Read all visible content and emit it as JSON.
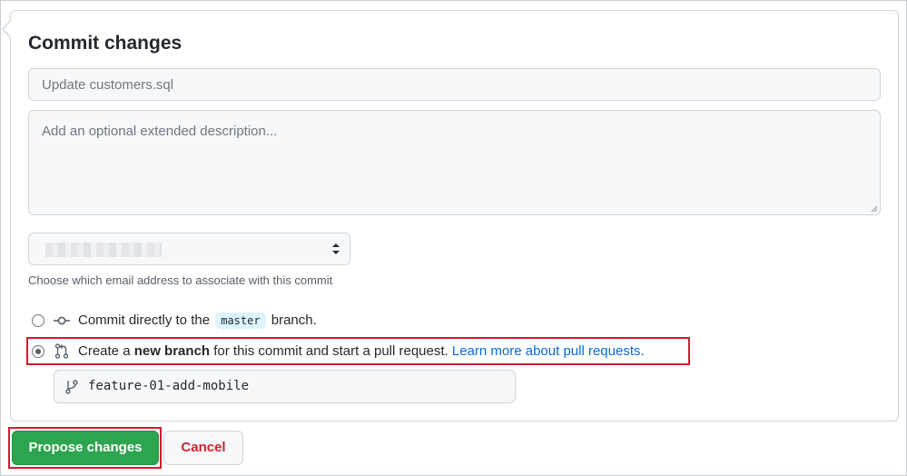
{
  "form": {
    "title": "Commit changes",
    "summary_placeholder": "Update customers.sql",
    "description_placeholder": "Add an optional extended description...",
    "email_help": "Choose which email address to associate with this commit"
  },
  "options": {
    "direct": {
      "prefix": "Commit directly to the",
      "branch": "master",
      "suffix": "branch."
    },
    "new_branch": {
      "prefix": "Create a",
      "bold": "new branch",
      "suffix": "for this commit and start a pull request.",
      "link": "Learn more about pull requests.",
      "selected": true
    }
  },
  "branch_name": "feature-01-add-mobile",
  "buttons": {
    "propose": "Propose changes",
    "cancel": "Cancel"
  },
  "icons": {
    "commit": "git-commit-icon",
    "pull_request": "git-pull-request-icon",
    "branch": "git-branch-icon",
    "select": "select-arrows-icon"
  },
  "colors": {
    "primary_button": "#2da44e",
    "cancel_text": "#cf222e",
    "link": "#0969da",
    "highlight": "#d31b2f"
  }
}
